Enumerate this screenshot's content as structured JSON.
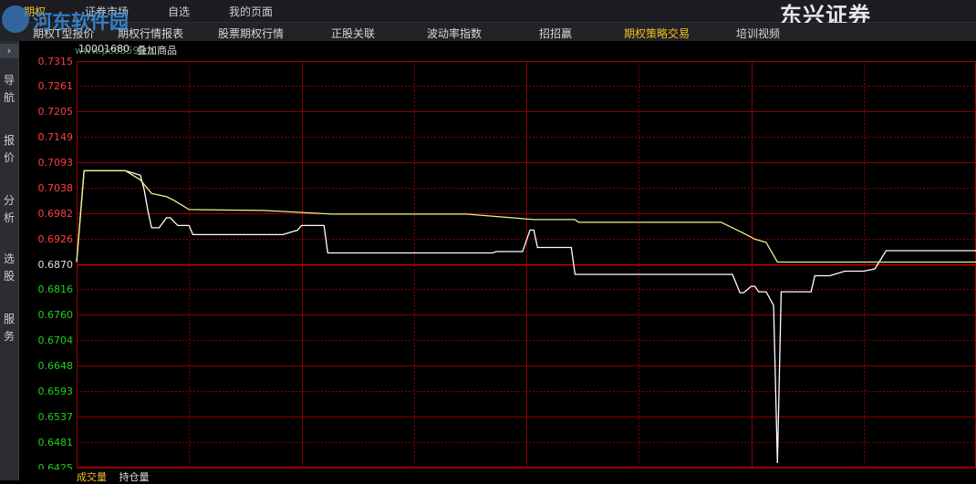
{
  "top_menu": {
    "items": [
      "期权",
      "证券市场",
      "自选",
      "我的页面"
    ],
    "active_index": 0
  },
  "brand": "东兴证券",
  "sub_menu": {
    "items": [
      "期权T型报价",
      "期权行情报表",
      "股票期权行情",
      "正股关联",
      "波动率指数",
      "招招赢",
      "期权策略交易",
      "培训视频"
    ],
    "active_index": 6
  },
  "sidebar": {
    "expand_glyph": "›",
    "items": [
      "导航",
      "报价",
      "分析",
      "选股",
      "服务"
    ]
  },
  "watermark": {
    "text": "河东软件园",
    "url": "www.pc0359.cn"
  },
  "chart_header": {
    "code": "10001680",
    "overlay_button": "叠加商品"
  },
  "bottom_tabs": [
    "成交量",
    "持仓量"
  ],
  "colors": {
    "up": "#ff4040",
    "down": "#20d020",
    "neutral": "#e0e0e0",
    "grid": "#8b0000",
    "price_line": "#ffffff",
    "avg_line": "#f0f08c",
    "accent": "#f0c020"
  },
  "chart_data": {
    "type": "line",
    "y_ticks": [
      "0.7315",
      "0.7261",
      "0.7205",
      "0.7149",
      "0.7093",
      "0.7038",
      "0.6982",
      "0.6926",
      "0.6870",
      "0.6816",
      "0.6760",
      "0.6704",
      "0.6648",
      "0.6593",
      "0.6537",
      "0.6481",
      "0.6425"
    ],
    "ylim": [
      0.6425,
      0.7315
    ],
    "reference": 0.687,
    "xlim": [
      0,
      240
    ],
    "series": [
      {
        "role": "price",
        "points": [
          [
            0,
            0.6875
          ],
          [
            2,
            0.7075
          ],
          [
            13,
            0.7075
          ],
          [
            17,
            0.7065
          ],
          [
            18,
            0.7035
          ],
          [
            19,
            0.6988
          ],
          [
            20,
            0.695
          ],
          [
            22,
            0.695
          ],
          [
            24,
            0.6972
          ],
          [
            25,
            0.6972
          ],
          [
            27,
            0.6955
          ],
          [
            30,
            0.6955
          ],
          [
            31,
            0.6935
          ],
          [
            55,
            0.6935
          ],
          [
            59,
            0.6945
          ],
          [
            60,
            0.6955
          ],
          [
            66,
            0.6955
          ],
          [
            67,
            0.6895
          ],
          [
            111,
            0.6895
          ],
          [
            112,
            0.6898
          ],
          [
            119,
            0.6898
          ],
          [
            121,
            0.6945
          ],
          [
            122,
            0.6945
          ],
          [
            123,
            0.6907
          ],
          [
            132,
            0.6907
          ],
          [
            133,
            0.6848
          ],
          [
            164,
            0.6848
          ],
          [
            175,
            0.6848
          ],
          [
            177,
            0.6808
          ],
          [
            178,
            0.6808
          ],
          [
            180,
            0.6822
          ],
          [
            181,
            0.6822
          ],
          [
            182,
            0.681
          ],
          [
            184,
            0.681
          ],
          [
            186,
            0.678
          ],
          [
            187,
            0.6435
          ],
          [
            188,
            0.681
          ],
          [
            196,
            0.681
          ],
          [
            197,
            0.6845
          ],
          [
            201,
            0.6845
          ],
          [
            205,
            0.6855
          ],
          [
            210,
            0.6855
          ],
          [
            213,
            0.686
          ],
          [
            214,
            0.6873
          ],
          [
            216,
            0.69
          ],
          [
            240,
            0.69
          ]
        ]
      },
      {
        "role": "average",
        "points": [
          [
            0,
            0.6875
          ],
          [
            2,
            0.7075
          ],
          [
            13,
            0.7075
          ],
          [
            17,
            0.7055
          ],
          [
            20,
            0.7025
          ],
          [
            24,
            0.7018
          ],
          [
            26,
            0.701
          ],
          [
            30,
            0.699
          ],
          [
            50,
            0.6988
          ],
          [
            68,
            0.698
          ],
          [
            104,
            0.698
          ],
          [
            122,
            0.6968
          ],
          [
            133,
            0.6968
          ],
          [
            134,
            0.6962
          ],
          [
            155,
            0.6962
          ],
          [
            172,
            0.6962
          ],
          [
            175,
            0.695
          ],
          [
            178,
            0.6938
          ],
          [
            181,
            0.6925
          ],
          [
            184,
            0.6918
          ],
          [
            187,
            0.6875
          ],
          [
            240,
            0.6875
          ]
        ]
      }
    ]
  }
}
